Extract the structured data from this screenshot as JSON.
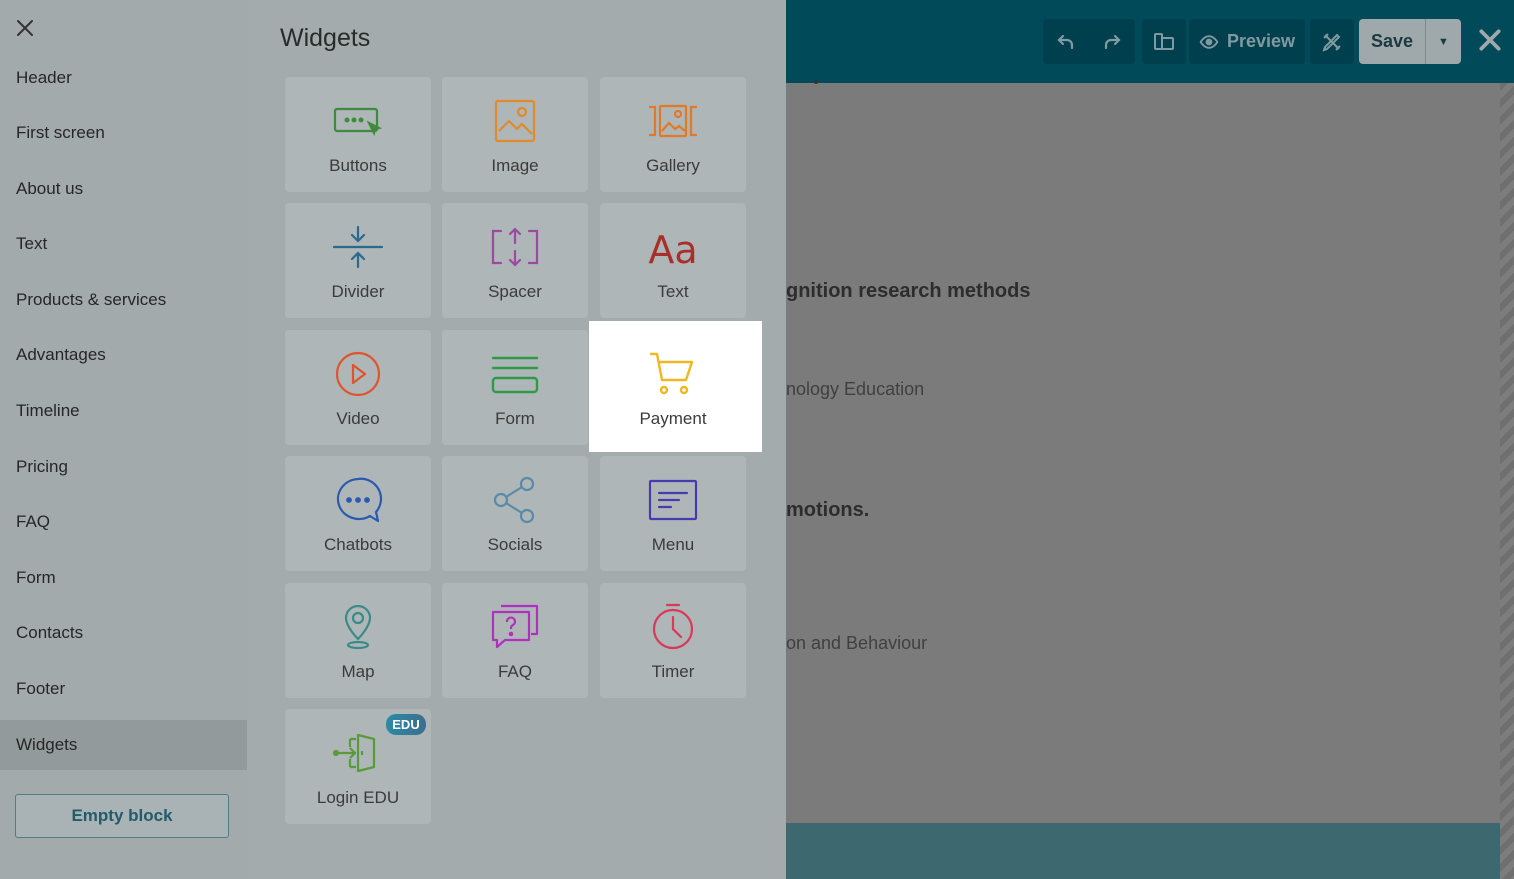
{
  "editor": {
    "toolbar": {
      "preview_label": "Preview",
      "save_label": "Save"
    },
    "canvas_text": [
      "gnition research methods",
      "nology Education",
      "motions.",
      "on and Behaviour"
    ]
  },
  "sidebar": {
    "items": [
      {
        "label": "Header"
      },
      {
        "label": "First screen"
      },
      {
        "label": "About us"
      },
      {
        "label": "Text"
      },
      {
        "label": "Products & services"
      },
      {
        "label": "Advantages"
      },
      {
        "label": "Timeline"
      },
      {
        "label": "Pricing"
      },
      {
        "label": "FAQ"
      },
      {
        "label": "Form"
      },
      {
        "label": "Contacts"
      },
      {
        "label": "Footer"
      },
      {
        "label": "Widgets"
      }
    ],
    "active": "Widgets",
    "empty_block_label": "Empty block"
  },
  "widgets": {
    "title": "Widgets",
    "tiles": [
      {
        "label": "Buttons",
        "icon": "buttons-icon",
        "color": "#3f8a3c"
      },
      {
        "label": "Image",
        "icon": "image-icon",
        "color": "#e08a2a"
      },
      {
        "label": "Gallery",
        "icon": "gallery-icon",
        "color": "#e07a28"
      },
      {
        "label": "Divider",
        "icon": "divider-icon",
        "color": "#2a6a8a"
      },
      {
        "label": "Spacer",
        "icon": "spacer-icon",
        "color": "#9a4aa0"
      },
      {
        "label": "Text",
        "icon": "text-icon",
        "color": "#a8302c"
      },
      {
        "label": "Video",
        "icon": "video-icon",
        "color": "#e0532c"
      },
      {
        "label": "Form",
        "icon": "form-icon",
        "color": "#2e9a4a"
      },
      {
        "label": "Payment",
        "icon": "cart-icon",
        "color": "#f0b820"
      },
      {
        "label": "Chatbots",
        "icon": "chatbot-icon",
        "color": "#2a5ab0"
      },
      {
        "label": "Socials",
        "icon": "share-icon",
        "color": "#5a8aa8"
      },
      {
        "label": "Menu",
        "icon": "menu-icon",
        "color": "#4a3ab0"
      },
      {
        "label": "Map",
        "icon": "map-pin-icon",
        "color": "#3a8a8a"
      },
      {
        "label": "FAQ",
        "icon": "faq-icon",
        "color": "#b030c0"
      },
      {
        "label": "Timer",
        "icon": "timer-icon",
        "color": "#d83a5a"
      },
      {
        "label": "Login EDU",
        "icon": "login-icon",
        "color": "#5a9a3a",
        "badge": "EDU"
      }
    ],
    "highlighted": "Payment"
  }
}
